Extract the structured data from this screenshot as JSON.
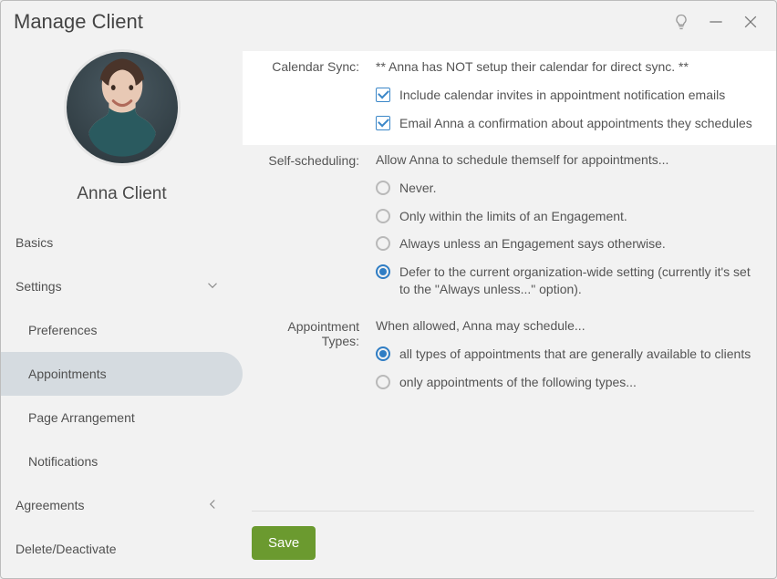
{
  "window": {
    "title": "Manage Client"
  },
  "client": {
    "name": "Anna Client"
  },
  "nav": {
    "basics": "Basics",
    "settings": "Settings",
    "preferences": "Preferences",
    "appointments": "Appointments",
    "page_arrangement": "Page Arrangement",
    "notifications": "Notifications",
    "agreements": "Agreements",
    "delete": "Delete/Deactivate"
  },
  "calendar_sync": {
    "label": "Calendar Sync:",
    "status": "** Anna has NOT setup their calendar for direct sync. **",
    "include_invites": "Include calendar invites in appointment notification emails",
    "email_confirmation": "Email Anna a confirmation about appointments they schedules"
  },
  "self_scheduling": {
    "label": "Self-scheduling:",
    "intro": "Allow Anna to schedule themself for appointments...",
    "never": "Never.",
    "engagement_limits": "Only within the limits of an Engagement.",
    "always_unless": "Always unless an Engagement says otherwise.",
    "defer": "Defer to the current organization-wide setting (currently it's set to the \"Always unless...\" option)."
  },
  "appointment_types": {
    "label": "Appointment Types:",
    "intro": "When allowed, Anna may schedule...",
    "all_types": "all types of appointments that are generally available to clients",
    "only_following": "only appointments of the following types..."
  },
  "actions": {
    "save": "Save"
  }
}
